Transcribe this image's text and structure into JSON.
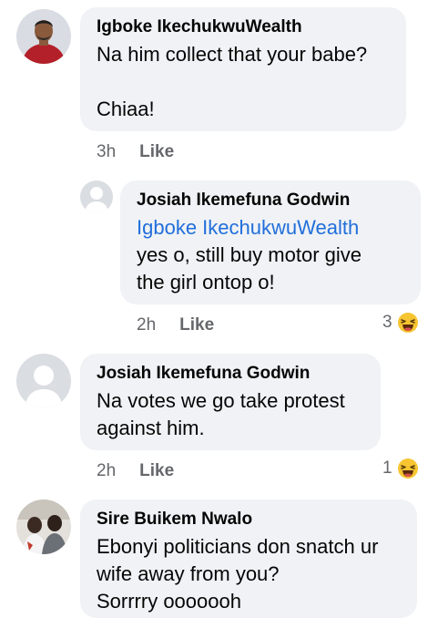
{
  "comments": [
    {
      "author": "Igboke IkechukwuWealth",
      "text": "Na him collect that your babe?\n\nChiaa!",
      "time": "3h",
      "like_label": "Like"
    },
    {
      "author": "Josiah Ikemefuna Godwin",
      "mention": "Igboke IkechukwuWealth",
      "text": "yes o, still buy motor give\nthe girl ontop o!",
      "time": "2h",
      "like_label": "Like",
      "reaction_count": "3",
      "reaction_icon": "laughing-emoji-icon"
    },
    {
      "author": "Josiah Ikemefuna Godwin",
      "text": "Na votes we go take protest\nagainst him.",
      "time": "2h",
      "like_label": "Like",
      "reaction_count": "1",
      "reaction_icon": "laughing-emoji-icon"
    },
    {
      "author": "Sire Buikem Nwalo",
      "text": "Ebonyi politicians don snatch ur\nwife away from you?\nSorrrry ooooooh"
    }
  ],
  "colors": {
    "bubble": "#f0f2f5",
    "meta": "#65676b",
    "mention": "#216fdb",
    "text": "#050505"
  }
}
